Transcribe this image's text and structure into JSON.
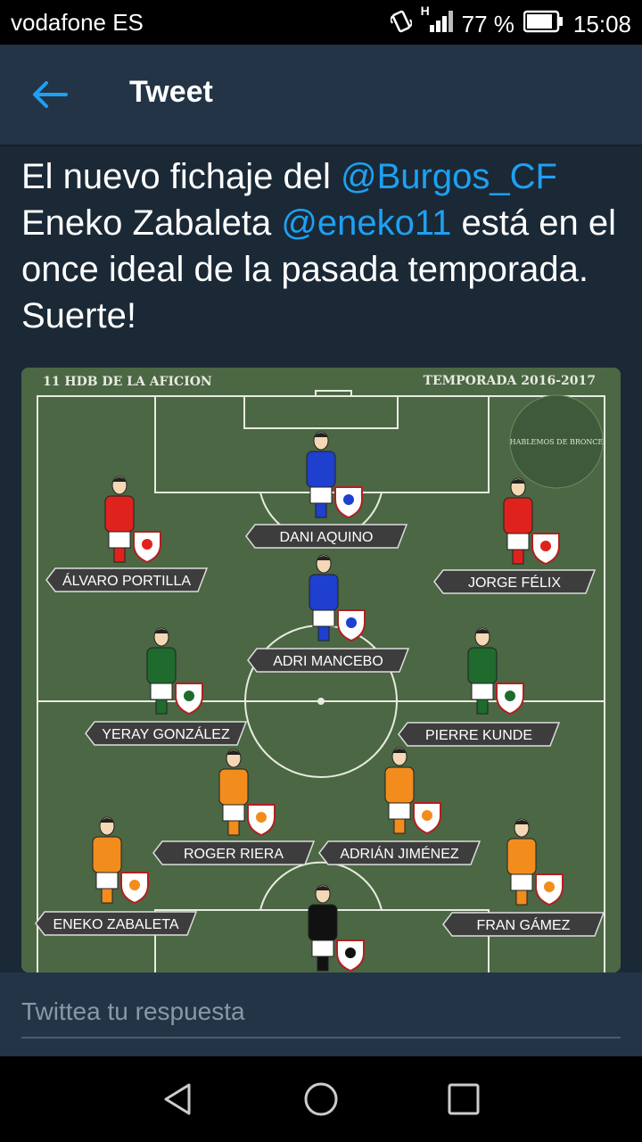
{
  "status_bar": {
    "carrier": "vodafone ES",
    "battery": "77 %",
    "time": "15:08",
    "network": "H",
    "icons": [
      "vibrate-icon",
      "signal-icon",
      "battery-icon"
    ]
  },
  "header": {
    "title": "Tweet",
    "back_icon": "arrow-left-icon",
    "accent": "#1da1f2"
  },
  "tweet": {
    "parts": [
      {
        "text": "El nuevo fichaje del ",
        "mention": false
      },
      {
        "text": "@Burgos_CF",
        "mention": true
      },
      {
        "text": " Eneko Zabaleta ",
        "mention": false
      },
      {
        "text": "@eneko11",
        "mention": true
      },
      {
        "text": " está en el once ideal de la pasada temporada. Suerte!",
        "mention": false
      }
    ]
  },
  "media": {
    "left_header": "11 HDB DE LA AFICION",
    "right_header": "TEMPORADA 2016-2017",
    "logo_text": "HABLEMOS DE BRONCE",
    "players": [
      {
        "name": "DANI AQUINO",
        "shirt": "#1f3fcf",
        "badge": "racing-badge-icon"
      },
      {
        "name": "ÁLVARO PORTILLA",
        "shirt": "#e0221e",
        "badge": "rayo-badge-icon"
      },
      {
        "name": "JORGE FÉLIX",
        "shirt": "#e0221e",
        "badge": "rayo-badge-icon"
      },
      {
        "name": "ADRI MANCEBO",
        "shirt": "#1f3fcf",
        "badge": "badge-icon"
      },
      {
        "name": "YERAY GONZÁLEZ",
        "shirt": "#1f6b2e",
        "badge": "leonesa-badge-icon"
      },
      {
        "name": "PIERRE KUNDE",
        "shirt": "#1f6b2e",
        "badge": "extremadura-badge-icon"
      },
      {
        "name": "ROGER RIERA",
        "shirt": "#f28c1c",
        "badge": "celta-badge-icon"
      },
      {
        "name": "ADRIÁN JIMÉNEZ",
        "shirt": "#f28c1c",
        "badge": "green-badge-icon"
      },
      {
        "name": "ENEKO ZABALETA",
        "shirt": "#f28c1c",
        "badge": "badge-icon"
      },
      {
        "name": "FRAN GÁMEZ",
        "shirt": "#f28c1c",
        "badge": "saguntino-badge-icon"
      },
      {
        "name": "",
        "shirt": "#111111",
        "badge": "badge-icon"
      }
    ]
  },
  "reply": {
    "placeholder": "Twittea tu respuesta"
  },
  "nav": {
    "icons": [
      "back-triangle-icon",
      "home-circle-icon",
      "recents-square-icon"
    ]
  }
}
